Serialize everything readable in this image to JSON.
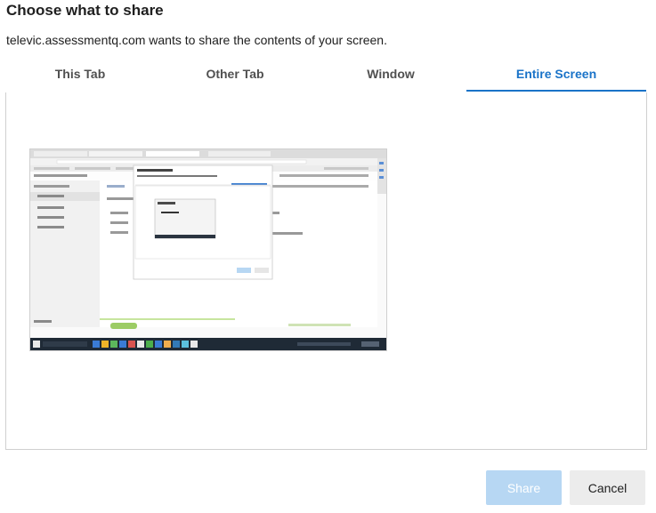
{
  "dialog": {
    "title": "Choose what to share",
    "subtitle": "televic.assessmentq.com wants to share the contents of your screen."
  },
  "tabs": [
    {
      "label": "This Tab",
      "active": false
    },
    {
      "label": "Other Tab",
      "active": false
    },
    {
      "label": "Window",
      "active": false
    },
    {
      "label": "Entire Screen",
      "active": true
    }
  ],
  "preview": {
    "icon": "desktop-screenshot-thumbnail",
    "taskbar_color": "#1f2a36",
    "accent": "#9ccc65"
  },
  "buttons": {
    "share_label": "Share",
    "share_enabled": false,
    "cancel_label": "Cancel"
  },
  "colors": {
    "accent": "#1a73c8",
    "share_disabled_bg": "#b7d7f3",
    "cancel_bg": "#ececec"
  }
}
